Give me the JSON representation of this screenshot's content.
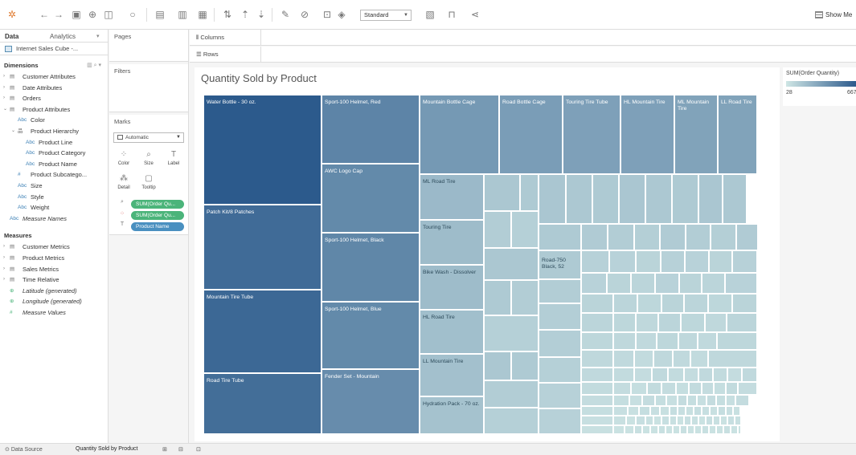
{
  "toolbar": {
    "view_mode": "Standard",
    "show_me": "Show Me",
    "icons": [
      "tableau-logo-icon",
      "back-icon",
      "forward-icon",
      "save-icon",
      "new-datasource-icon",
      "new-sheet-icon",
      "undo-icon",
      "new-worksheet-icon",
      "duplicate-icon",
      "clear-icon",
      "swap-icon",
      "sort-asc-icon",
      "sort-desc-icon",
      "highlight-icon",
      "group-icon",
      "label-icon",
      "format-icon",
      "fit-icon",
      "presentation-icon",
      "share-icon"
    ]
  },
  "left": {
    "tab_data": "Data",
    "tab_analytics": "Analytics",
    "datasource": "Internet Sales Cube -...",
    "dimensions_title": "Dimensions",
    "dimensions": [
      {
        "label": "Customer Attributes",
        "level": 0,
        "icon": "folder-icon",
        "expanded": false
      },
      {
        "label": "Date Attributes",
        "level": 0,
        "icon": "folder-icon",
        "expanded": false
      },
      {
        "label": "Orders",
        "level": 0,
        "icon": "folder-icon",
        "expanded": false
      },
      {
        "label": "Product Attributes",
        "level": 0,
        "icon": "folder-icon",
        "expanded": true
      },
      {
        "label": "Color",
        "level": 1,
        "icon": "abc-icon"
      },
      {
        "label": "Product Hierarchy",
        "level": 1,
        "icon": "hierarchy-icon",
        "expanded": true
      },
      {
        "label": "Product Line",
        "level": 2,
        "icon": "abc-icon"
      },
      {
        "label": "Product Category",
        "level": 2,
        "icon": "abc-icon"
      },
      {
        "label": "Product Name",
        "level": 2,
        "icon": "abc-icon"
      },
      {
        "label": "Product Subcatego...",
        "level": 1,
        "icon": "hash-icon"
      },
      {
        "label": "Size",
        "level": 1,
        "icon": "abc-icon"
      },
      {
        "label": "Style",
        "level": 1,
        "icon": "abc-icon"
      },
      {
        "label": "Weight",
        "level": 1,
        "icon": "abc-icon"
      },
      {
        "label": "Measure Names",
        "level": 0,
        "icon": "abc-icon",
        "italic": true
      }
    ],
    "measures_title": "Measures",
    "measures": [
      {
        "label": "Customer Metrics",
        "icon": "folder-icon"
      },
      {
        "label": "Product Metrics",
        "icon": "folder-icon"
      },
      {
        "label": "Sales Metrics",
        "icon": "folder-icon"
      },
      {
        "label": "Time Relative",
        "icon": "folder-icon"
      },
      {
        "label": "Latitude (generated)",
        "icon": "globe-icon",
        "italic": true
      },
      {
        "label": "Longitude (generated)",
        "icon": "globe-icon",
        "italic": true
      },
      {
        "label": "Measure Values",
        "icon": "hash-icon",
        "italic": true
      }
    ]
  },
  "cards": {
    "pages": "Pages",
    "filters": "Filters",
    "marks": "Marks",
    "mark_type": "Automatic",
    "mark_buttons": [
      {
        "label": "Color",
        "icon": "color-icon"
      },
      {
        "label": "Size",
        "icon": "size-icon"
      },
      {
        "label": "Label",
        "icon": "label-icon"
      },
      {
        "label": "Detail",
        "icon": "detail-icon"
      },
      {
        "label": "Tooltip",
        "icon": "tooltip-icon"
      }
    ],
    "pills": [
      {
        "label": "SUM(Order Qu...",
        "icon": "size-icon",
        "color": "green"
      },
      {
        "label": "SUM(Order Qu...",
        "icon": "color-icon",
        "color": "green"
      },
      {
        "label": "Product Name",
        "icon": "label-icon",
        "color": "blue"
      }
    ]
  },
  "shelves": {
    "columns": "Columns",
    "rows": "Rows"
  },
  "sheet": {
    "title": "Quantity Sold by Product",
    "legend_title": "SUM(Order Quantity)",
    "legend_min": "28",
    "legend_max": "667",
    "color_low": "#cfe6e5",
    "color_high": "#2c5a8c"
  },
  "bottom": {
    "datasource_tab": "Data Source",
    "sheet_tab": "Quantity Sold by Product"
  },
  "chart_data": {
    "type": "treemap",
    "title": "Quantity Sold by Product",
    "labeled_items": [
      "Water Bottle - 30 oz.",
      "Patch Kit/8 Patches",
      "Mountain Tire Tube",
      "Road Tire Tube",
      "Sport-100 Helmet, Red",
      "AWC Logo Cap",
      "Sport-100 Helmet, Black",
      "Sport-100 Helmet, Blue",
      "Fender Set - Mountain",
      "Mountain Bottle Cage",
      "Road Bottle Cage",
      "Touring Tire Tube",
      "HL Mountain Tire",
      "ML Mountain Tire",
      "LL Road Tire",
      "ML Road Tire",
      "Touring Tire",
      "Bike Wash - Dissolver",
      "HL Road Tire",
      "LL Mountain Tire",
      "Hydration Pack - 70 oz.",
      "Road-750 Black, 52"
    ]
  }
}
